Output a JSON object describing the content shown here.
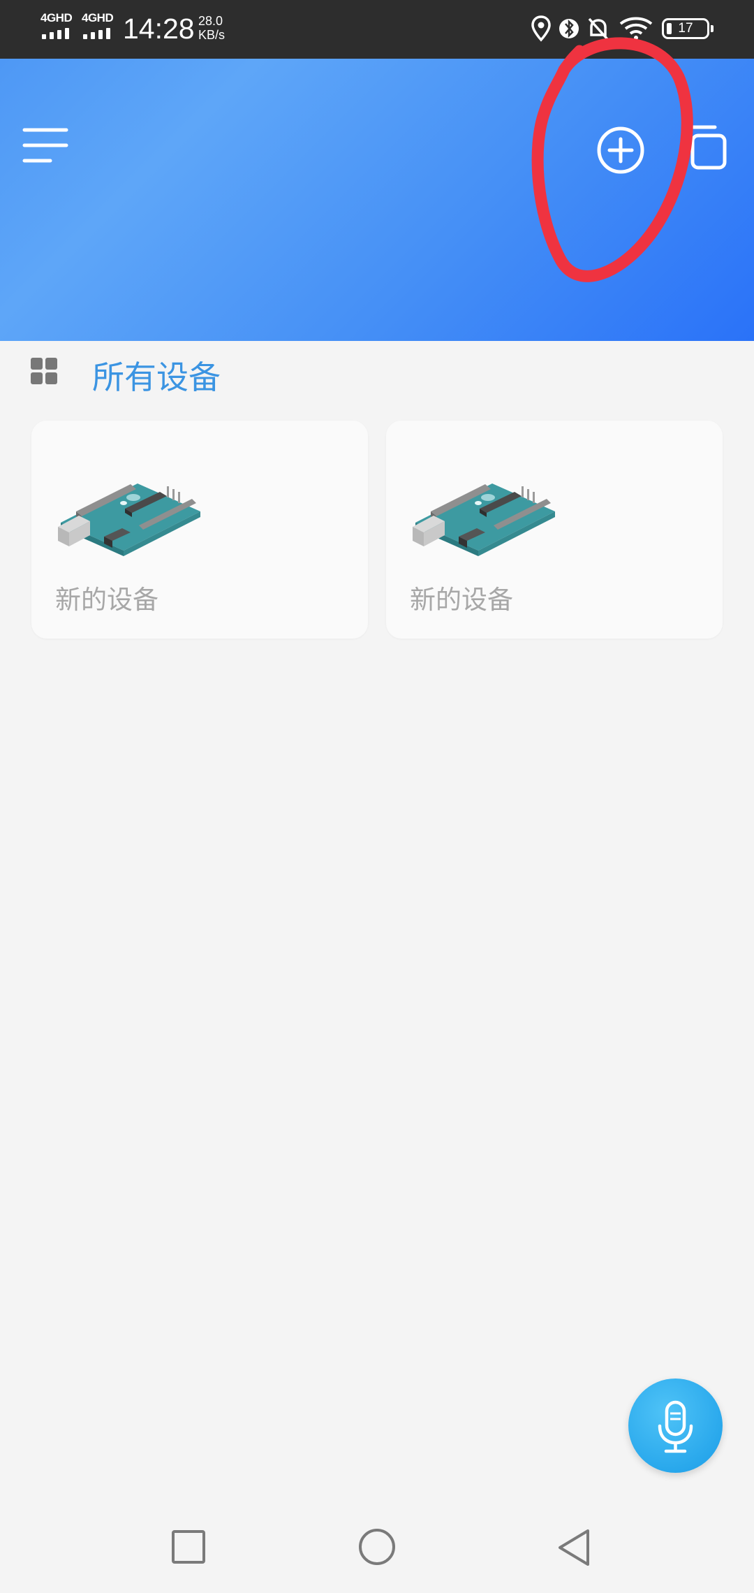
{
  "status_bar": {
    "signal1_label": "4GHD",
    "signal2_label": "4GHD",
    "time": "14:28",
    "net_speed_value": "28.0",
    "net_speed_unit": "KB/s",
    "battery_level": "17",
    "icons": [
      "location-icon",
      "bluetooth-icon",
      "alarm-off-icon",
      "wifi-icon",
      "battery-icon"
    ]
  },
  "header": {
    "menu_icon": "menu-icon",
    "add_icon": "add-circle-icon",
    "copy_icon": "copy-icon",
    "gradient_colors": [
      "#4e98f5",
      "#2a72f8"
    ]
  },
  "section": {
    "icon": "grid-icon",
    "title": "所有设备"
  },
  "devices": [
    {
      "name": "新的设备",
      "image": "arduino-board"
    },
    {
      "name": "新的设备",
      "image": "arduino-board"
    }
  ],
  "fab": {
    "icon": "microphone-icon",
    "color": "#29a8ec"
  },
  "navbar": {
    "icons": [
      "recents-square-icon",
      "home-circle-icon",
      "back-triangle-icon"
    ]
  },
  "annotation_color": "#ef3340"
}
